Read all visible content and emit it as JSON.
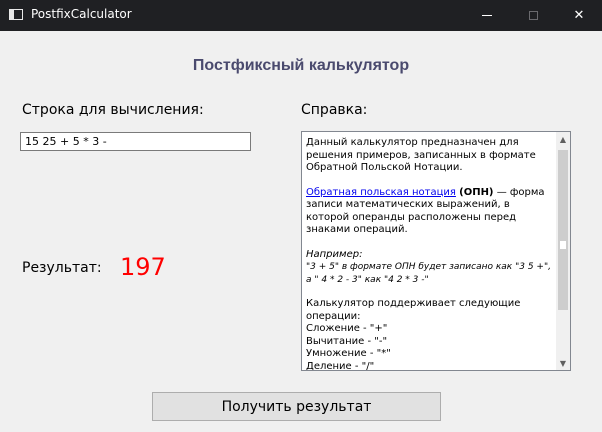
{
  "window": {
    "title": "PostfixCalculator",
    "close_glyph": "✕"
  },
  "heading": "Постфиксный калькулятор",
  "expression": {
    "label": "Строка для вычисления:",
    "value": "15 25 + 5 * 3 -"
  },
  "help": {
    "label": "Справка:",
    "intro": "Данный калькулятор предназначен для решения примеров, записанных в формате Обратной Польской Нотации.",
    "link_text": "Обратная польская нотация",
    "abbr": "(ОПН)",
    "definition": " — форма записи математических выражений, в которой операнды расположены перед знаками операций.",
    "example_heading": "Например:",
    "example_text": "\"3 + 5\" в формате ОПН будет записано как \"3 5 +\", а \" 4 * 2  - 3\" как \"4 2 * 3 -\"",
    "ops_intro": "Калькулятор поддерживает следующие операции:",
    "operations": [
      "Сложение - \"+\"",
      "Вычитание - \"-\"",
      "Умножение - \"*\"",
      "Деление - \"/\""
    ],
    "scroll_up_glyph": "▲",
    "scroll_down_glyph": "▼"
  },
  "result": {
    "label": "Результат:",
    "value": "197",
    "color": "#ff0000"
  },
  "button": {
    "label": "Получить результат"
  }
}
